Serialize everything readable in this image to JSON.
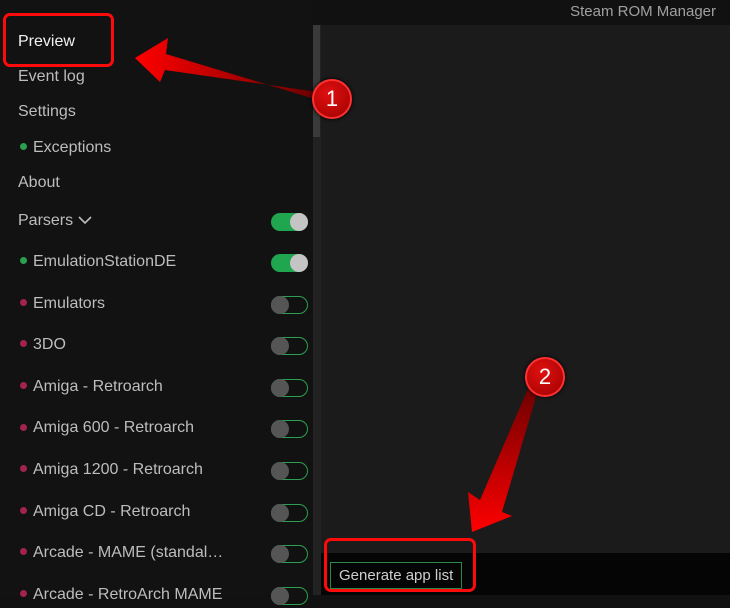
{
  "app_title": "Steam ROM Manager",
  "nav": [
    {
      "label": "Preview"
    },
    {
      "label": "Event log"
    },
    {
      "label": "Settings"
    },
    {
      "label": "Exceptions"
    },
    {
      "label": "About"
    }
  ],
  "parsers_label": "Parsers",
  "parsers": [
    {
      "label": "EmulationStationDE",
      "enabled": true,
      "status": "green"
    },
    {
      "label": "Emulators",
      "enabled": false,
      "status": "red"
    },
    {
      "label": "3DO",
      "enabled": false,
      "status": "red"
    },
    {
      "label": "Amiga - Retroarch",
      "enabled": false,
      "status": "red"
    },
    {
      "label": "Amiga 600 - Retroarch",
      "enabled": false,
      "status": "red"
    },
    {
      "label": "Amiga 1200 - Retroarch",
      "enabled": false,
      "status": "red"
    },
    {
      "label": "Amiga CD - Retroarch",
      "enabled": false,
      "status": "red"
    },
    {
      "label": "Arcade - MAME (standalone)",
      "enabled": false,
      "status": "red"
    },
    {
      "label": "Arcade - RetroArch MAME",
      "enabled": false,
      "status": "red"
    }
  ],
  "generate_label": "Generate app list",
  "annotations": {
    "one": "1",
    "two": "2"
  },
  "colors": {
    "green": "#2aa050",
    "red": "#a3234f",
    "accent": "#ff0a0a"
  }
}
